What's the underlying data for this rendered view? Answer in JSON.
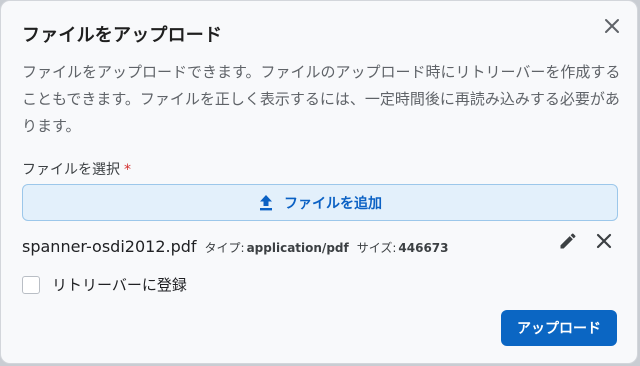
{
  "dialog": {
    "title": "ファイルをアップロード",
    "description": "ファイルをアップロードできます。ファイルのアップロード時にリトリーバーを作成することもできます。ファイルを正しく表示するには、一定時間後に再読み込みする必要があります。",
    "close_icon": "close-icon"
  },
  "file_select": {
    "label": "ファイルを選択",
    "required_mark": "*",
    "add_button_label": "ファイルを追加",
    "add_icon": "upload-icon"
  },
  "file": {
    "name": "spanner-osdi2012.pdf",
    "type_label": "タイプ:",
    "type_value": "application/pdf",
    "size_label": "サイズ:",
    "size_value": "446673",
    "edit_icon": "pencil-icon",
    "remove_icon": "close-icon"
  },
  "retriever": {
    "label": "リトリーバーに登録",
    "checked": false
  },
  "actions": {
    "upload_label": "アップロード"
  },
  "colors": {
    "accent": "#0b66c3",
    "add_button_bg": "#e3f0fb",
    "required": "#d32f2f"
  }
}
